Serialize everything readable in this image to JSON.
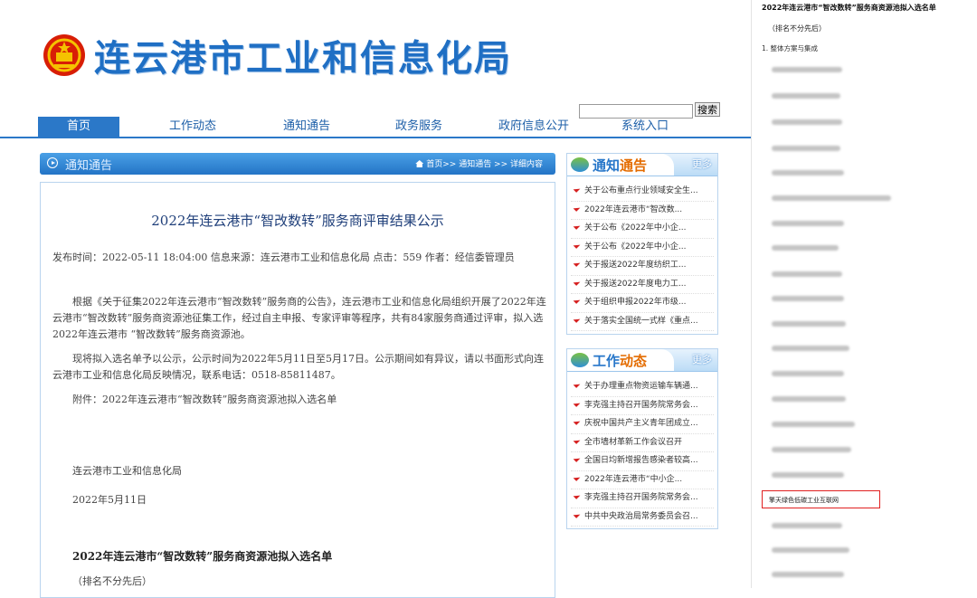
{
  "site": {
    "title": "连云港市工业和信息化局"
  },
  "search": {
    "placeholder": "",
    "button": "搜索"
  },
  "nav": [
    {
      "label": "首页",
      "active": true
    },
    {
      "label": "工作动态"
    },
    {
      "label": "通知通告"
    },
    {
      "label": "政务服务"
    },
    {
      "label": "政府信息公开"
    },
    {
      "label": "系统入口"
    }
  ],
  "main": {
    "bar_title": "通知通告",
    "breadcrumb": "首页>> 通知通告 >> 详细内容"
  },
  "article": {
    "title": "2022年连云港市“智改数转”服务商评审结果公示",
    "meta": "发布时间：2022-05-11 18:04:00 信息来源：连云港市工业和信息化局 点击：559 作者：经信委管理员",
    "paragraphs": [
      "根据《关于征集2022年连云港市“智改数转”服务商的公告》，连云港市工业和信息化局组织开展了2022年连云港市“智改数转”服务商资源池征集工作，经过自主申报、专家评审等程序，共有84家服务商通过评审，拟入选2022年连云港市 “智改数转”服务商资源池。",
      "现将拟入选名单予以公示，公示时间为2022年5月11日至5月17日。公示期间如有异议，请以书面形式向连云港市工业和信息化局反映情况，联系电话：0518-85811487。",
      "附件：2022年连云港市“智改数转”服务商资源池拟入选名单"
    ],
    "signature": "连云港市工业和信息化局",
    "date": "2022年5月11日",
    "list_title": "2022年连云港市“智改数转”服务商资源池拟入选名单",
    "list_note": "（排名不分先后）"
  },
  "notice_box": {
    "title_a": "通知",
    "title_b": "通告",
    "more": "更多",
    "items": [
      "关于公布重点行业领域安全生...",
      "2022年连云港市“智改数...",
      "关于公布《2022年中小企...",
      "关于公布《2022年中小企...",
      "关于报送2022年度纺织工...",
      "关于报送2022年度电力工...",
      "关于组织申报2022年市级...",
      "关于落实全国统一式样《重点..."
    ]
  },
  "work_box": {
    "title_a": "工作",
    "title_b": "动态",
    "more": "更多",
    "items": [
      "关于办理重点物资运输车辆通...",
      "李克强主持召开国务院常务会...",
      "庆祝中国共产主义青年团成立...",
      "全市墙材革新工作会议召开",
      "全国日均新增报告感染者较高...",
      "2022年连云港市“中小企...",
      "李克强主持召开国务院常务会...",
      "中共中央政治局常务委员会召..."
    ]
  },
  "overlay": {
    "title": "2022年连云港市“智改数转”服务商资源池拟入选名单",
    "subtitle": "（排名不分先后）",
    "section": "1. 整体方案与集成",
    "highlighted": "擎天绿色低碳工业互联网",
    "highlight_color": "#e02020"
  }
}
